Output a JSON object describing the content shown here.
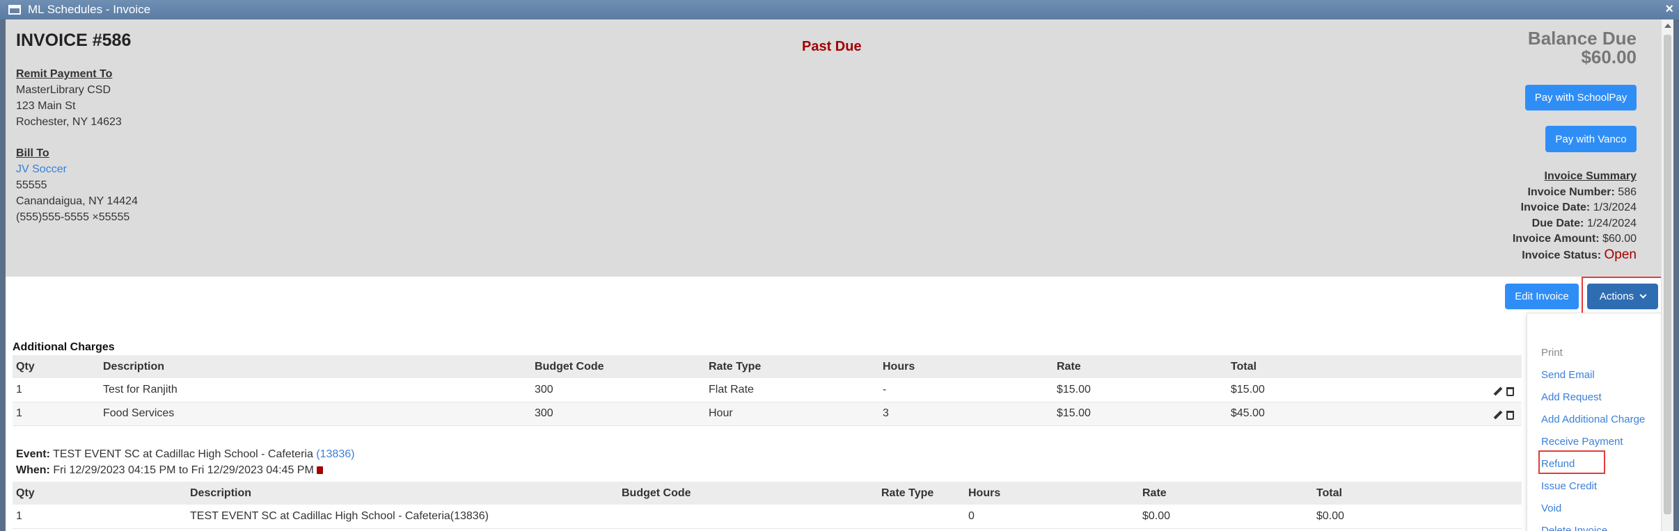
{
  "window": {
    "title": "ML Schedules - Invoice",
    "close_glyph": "×"
  },
  "invoice": {
    "title": "INVOICE #586",
    "status_banner": "Past Due",
    "remit": {
      "label": "Remit Payment To",
      "line1": "MasterLibrary CSD",
      "line2": "123 Main St",
      "line3": "Rochester, NY 14623"
    },
    "bill_to": {
      "label": "Bill To",
      "name": "JV Soccer",
      "line1": "55555",
      "line2": "Canandaigua, NY 14424",
      "line3": "(555)555-5555 ×55555"
    },
    "balance": {
      "label": "Balance Due",
      "amount": "$60.00"
    },
    "buttons": {
      "schoolpay": "Pay with SchoolPay",
      "vanco": "Pay with Vanco",
      "edit": "Edit Invoice",
      "actions": "Actions"
    },
    "summary": {
      "title": "Invoice Summary",
      "number_label": "Invoice Number:",
      "number": "586",
      "date_label": "Invoice Date:",
      "date": "1/3/2024",
      "due_label": "Due Date:",
      "due": "1/24/2024",
      "amount_label": "Invoice Amount:",
      "amount": "$60.00",
      "status_label": "Invoice Status:",
      "status": "Open"
    }
  },
  "additional_charges": {
    "title": "Additional Charges",
    "headers": [
      "Qty",
      "Description",
      "Budget Code",
      "Rate Type",
      "Hours",
      "Rate",
      "Total"
    ],
    "rows": [
      [
        "1",
        "Test for Ranjith",
        "300",
        "Flat Rate",
        "-",
        "$15.00",
        "$15.00"
      ],
      [
        "1",
        "Food Services",
        "300",
        "Hour",
        "3",
        "$15.00",
        "$45.00"
      ]
    ]
  },
  "event": {
    "event_label": "Event:",
    "event_text": "TEST EVENT SC at Cadillac High School - Cafeteria",
    "event_id": "(13836)",
    "when_label": "When:",
    "when_text": "Fri 12/29/2023 04:15 PM to Fri 12/29/2023 04:45 PM",
    "headers": [
      "Qty",
      "Description",
      "Budget Code",
      "Rate Type",
      "Hours",
      "Rate",
      "Total"
    ],
    "rows": [
      [
        "1",
        "TEST EVENT SC at Cadillac High School - Cafeteria(13836)",
        "",
        "",
        "0",
        "$0.00",
        "$0.00"
      ]
    ]
  },
  "actions_menu": {
    "print": "Print",
    "send_email": "Send Email",
    "add_request": "Add Request",
    "add_additional_charge": "Add Additional Charge",
    "receive_payment": "Receive Payment",
    "refund": "Refund",
    "issue_credit": "Issue Credit",
    "void": "Void",
    "delete_invoice": "Delete Invoice"
  },
  "colors": {
    "accent": "#2f8ef6",
    "actions": "#2f6db3",
    "alert": "#a30000",
    "highlight": "#e23c3c"
  }
}
